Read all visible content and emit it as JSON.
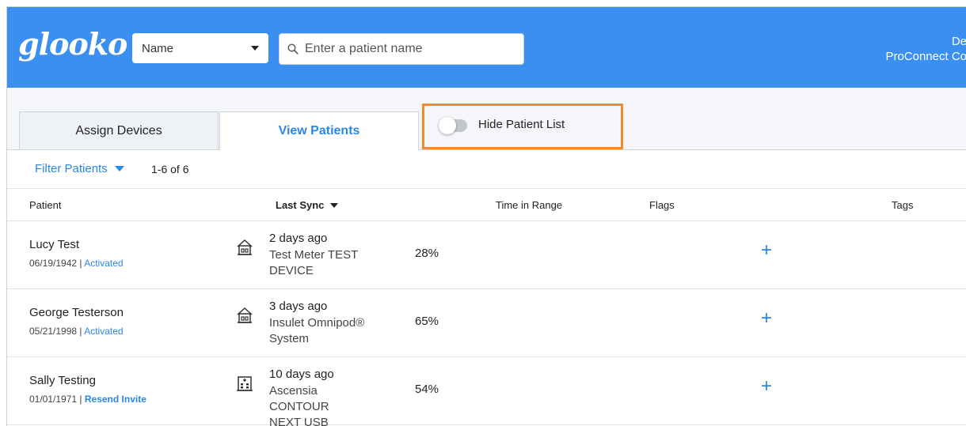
{
  "header": {
    "logo": "glooko",
    "search_type": "Name",
    "search_placeholder": "Enter a patient name",
    "user_line1": "De",
    "user_line2": "ProConnect Co"
  },
  "tabs": [
    {
      "label": "Assign Devices",
      "active": false
    },
    {
      "label": "View Patients",
      "active": true
    }
  ],
  "toggle": {
    "label": "Hide Patient List",
    "on": false
  },
  "filter": {
    "label": "Filter Patients",
    "count": "1-6 of 6"
  },
  "columns": {
    "patient": "Patient",
    "last_sync": "Last Sync",
    "time_in_range": "Time in Range",
    "flags": "Flags",
    "tags": "Tags"
  },
  "rows": [
    {
      "name": "Lucy Test",
      "dob": "06/19/1942",
      "status": "Activated",
      "location_icon": "home-icon",
      "sync_when": "2 days ago",
      "device_line1": "Test Meter TEST",
      "device_line2": "DEVICE",
      "tir": "28%",
      "add": "+"
    },
    {
      "name": "George Testerson",
      "dob": "05/21/1998",
      "status": "Activated",
      "location_icon": "home-icon",
      "sync_when": "3 days ago",
      "device_line1": "Insulet Omnipod®",
      "device_line2": "System",
      "tir": "65%",
      "add": "+"
    },
    {
      "name": "Sally Testing",
      "dob": "01/01/1971",
      "status": "Resend Invite",
      "location_icon": "clinic-building-icon",
      "sync_when": "10 days ago",
      "device_line1": "Ascensia CONTOUR",
      "device_line2": "NEXT USB",
      "tir": "54%",
      "add": "+"
    }
  ],
  "colors": {
    "header_blue": "#3b8ff0",
    "link_blue": "#2b87e3",
    "highlight_orange": "#f28a2c"
  }
}
